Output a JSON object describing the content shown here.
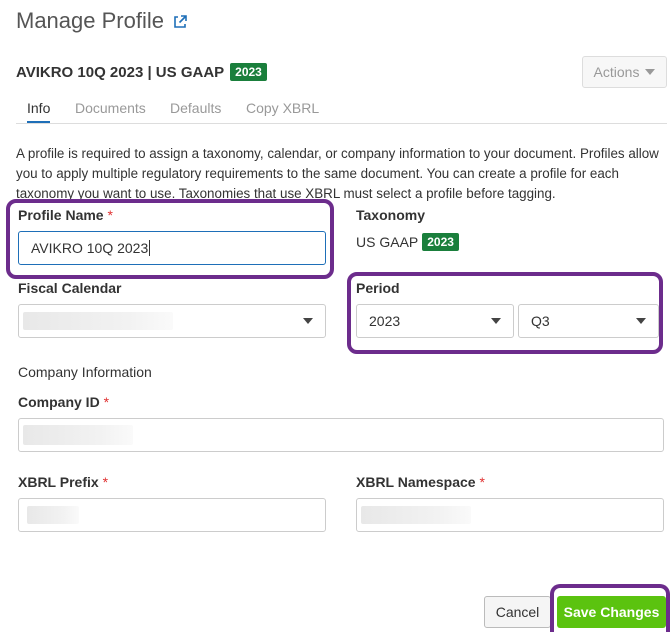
{
  "dialog": {
    "title": "Manage Profile",
    "document_title": "AVIKRO 10Q 2023 | US GAAP",
    "document_year_badge": "2023",
    "actions_label": "Actions"
  },
  "tabs": [
    {
      "label": "Info",
      "active": true
    },
    {
      "label": "Documents",
      "active": false
    },
    {
      "label": "Defaults",
      "active": false
    },
    {
      "label": "Copy XBRL",
      "active": false
    }
  ],
  "description": "A profile is required to assign a taxonomy, calendar, or company information to your document. Profiles allow you to apply multiple regulatory requirements to the same document. You can create a profile for each taxonomy you want to use. Taxonomies that use XBRL must select a profile before tagging.",
  "fields": {
    "profile_name": {
      "label": "Profile Name",
      "required_mark": "*",
      "value": "AVIKRO 10Q 2023"
    },
    "taxonomy": {
      "label": "Taxonomy",
      "value": "US GAAP",
      "badge": "2023"
    },
    "fiscal_calendar": {
      "label": "Fiscal Calendar"
    },
    "period": {
      "label": "Period",
      "year": "2023",
      "quarter": "Q3"
    },
    "company_section_label": "Company Information",
    "company_id": {
      "label": "Company ID",
      "required_mark": "*"
    },
    "xbrl_prefix": {
      "label": "XBRL Prefix",
      "required_mark": "*"
    },
    "xbrl_namespace": {
      "label": "XBRL Namespace",
      "required_mark": "*"
    }
  },
  "footer": {
    "cancel_label": "Cancel",
    "save_label": "Save Changes"
  },
  "colors": {
    "badge_green": "#1a7f3c",
    "save_green": "#5bc30f",
    "highlight_purple": "#6c2c8c",
    "tab_active_underline": "#1e6fb8",
    "required_red": "#e03030"
  },
  "icons": [
    "external-link-icon",
    "chevron-down-icon"
  ]
}
